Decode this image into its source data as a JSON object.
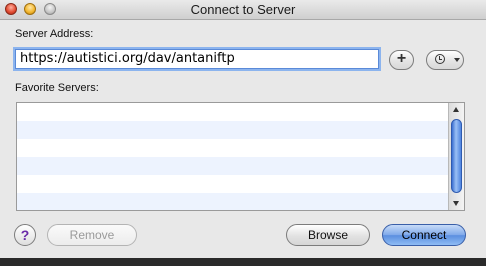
{
  "window": {
    "title": "Connect to Server"
  },
  "server": {
    "label": "Server Address:",
    "value": "https://autistici.org/dav/antaniftp"
  },
  "buttons": {
    "add": "+",
    "help": "?",
    "remove": "Remove",
    "browse": "Browse",
    "connect": "Connect"
  },
  "favorites": {
    "label": "Favorite Servers:",
    "items": []
  },
  "colors": {
    "connect_accent": "#5a8ee0",
    "focus_ring": "#8cb4ee",
    "row_alt": "#edf3fe",
    "help_glyph": "#6a2aa8"
  }
}
